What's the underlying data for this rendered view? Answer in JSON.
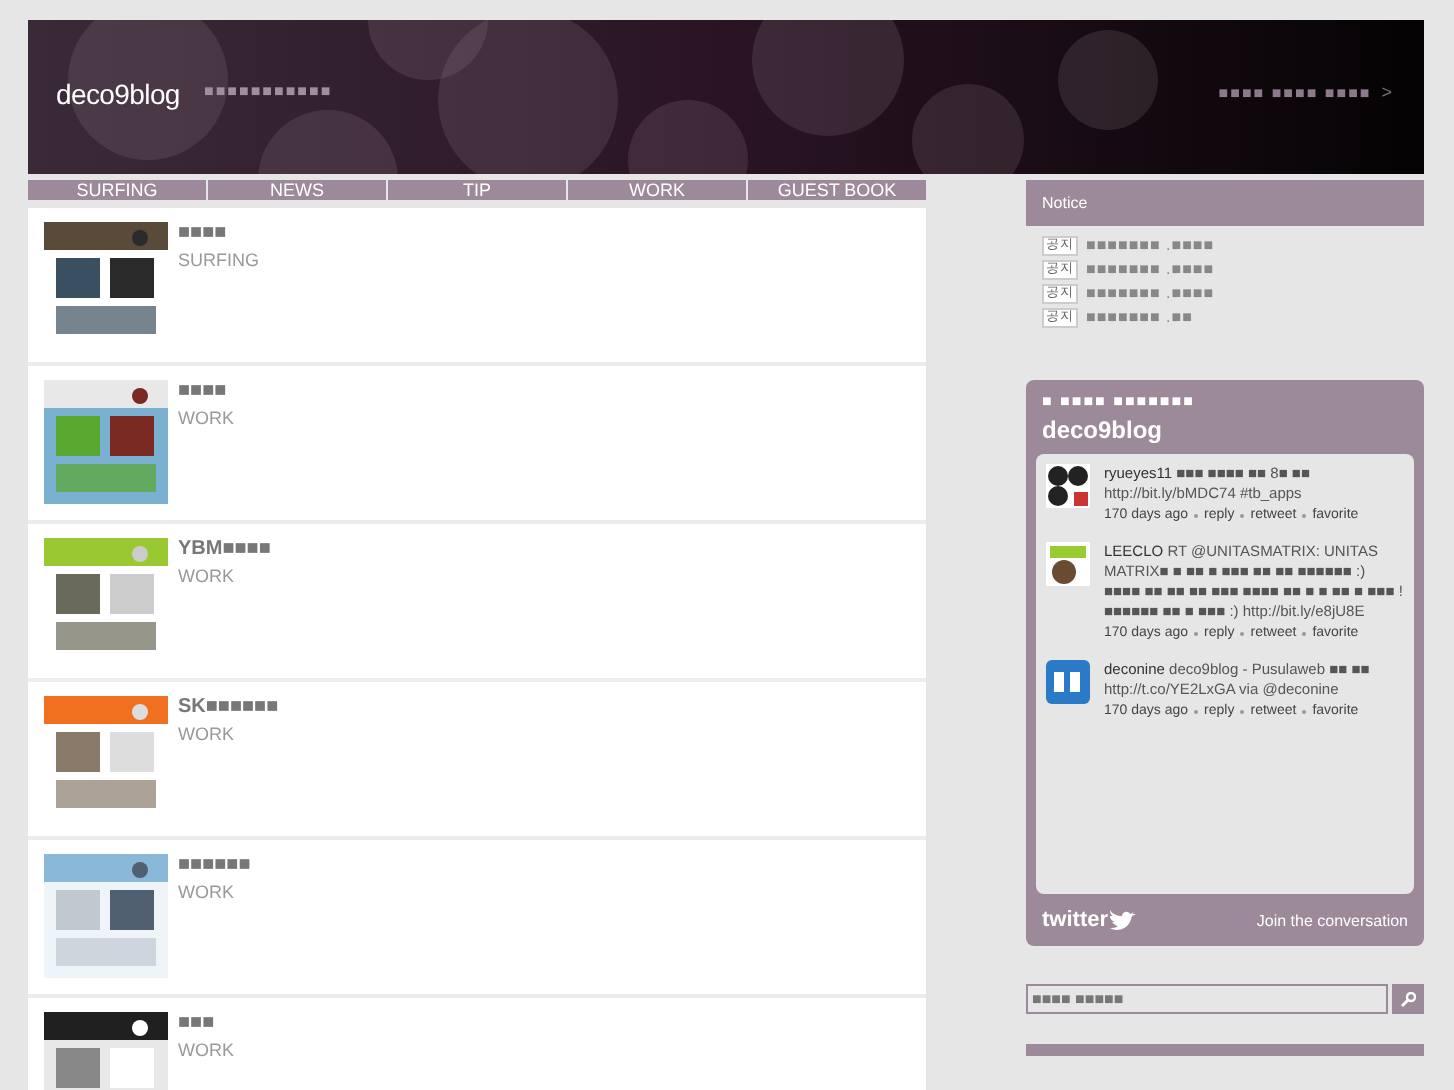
{
  "header": {
    "title": "deco9blog",
    "subtitle": "■■■■■■■■■■■",
    "right_link": "■■■■ ■■■■ ■■■■",
    "right_arrow": ">"
  },
  "nav": [
    {
      "label": "SURFING"
    },
    {
      "label": "NEWS"
    },
    {
      "label": "TIP"
    },
    {
      "label": "WORK"
    },
    {
      "label": "GUEST BOOK"
    }
  ],
  "posts": [
    {
      "title": "■■■■",
      "category": "SURFING"
    },
    {
      "title": "■■■■",
      "category": "WORK"
    },
    {
      "title": "YBM■■■■",
      "category": "WORK"
    },
    {
      "title": "SK■■■■■■",
      "category": "WORK"
    },
    {
      "title": "■■■■■■",
      "category": "WORK"
    },
    {
      "title": "■■■",
      "category": "WORK"
    }
  ],
  "notice": {
    "title": "Notice",
    "items": [
      {
        "badge": "공지",
        "text": "■■■■■■■ .■■■■"
      },
      {
        "badge": "공지",
        "text": "■■■■■■■ .■■■■"
      },
      {
        "badge": "공지",
        "text": "■■■■■■■ .■■■■"
      },
      {
        "badge": "공지",
        "text": "■■■■■■■ .■■"
      }
    ]
  },
  "twitter": {
    "caption": "■ ■■■■ ■■■■■■■",
    "account": "deco9blog",
    "tweets": [
      {
        "user": "ryueyes11",
        "text": "■■■ ■■■■ ■■ 8■ ■■ http://bit.ly/bMDC74 #tb_apps",
        "time": "170 days ago",
        "actions": [
          "reply",
          "retweet",
          "favorite"
        ]
      },
      {
        "user": "LEECLO",
        "text": "RT @UNITASMATRIX: UNITAS MATRIX■ ■ ■■ ■ ■■■ ■■ ■■ ■■■■■■ :) ■■■■ ■■ ■■ ■■ ■■■ ■■■■ ■■ ■ ■ ■■ ■ ■■■ ! ■■■■■■ ■■ ■ ■■■ :) http://bit.ly/e8jU8E",
        "time": "170 days ago",
        "actions": [
          "reply",
          "retweet",
          "favorite"
        ]
      },
      {
        "user": "deconine",
        "text": "deco9blog - Pusulaweb ■■ ■■ http://t.co/YE2LxGA via @deconine",
        "time": "170 days ago",
        "actions": [
          "reply",
          "retweet",
          "favorite"
        ]
      }
    ],
    "logo": "twitter",
    "join": "Join the conversation"
  },
  "search": {
    "placeholder": "■■■■ ■■■■■"
  }
}
